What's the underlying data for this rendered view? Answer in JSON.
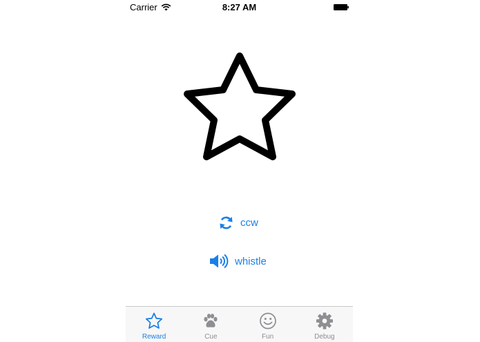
{
  "status_bar": {
    "carrier": "Carrier",
    "time": "8:27 AM"
  },
  "main": {
    "star_icon": "star-outline-icon",
    "actions": [
      {
        "label": "ccw",
        "icon": "refresh-icon"
      },
      {
        "label": "whistle",
        "icon": "speaker-icon"
      }
    ]
  },
  "tab_bar": {
    "tabs": [
      {
        "label": "Reward",
        "icon": "star-icon",
        "active": true
      },
      {
        "label": "Cue",
        "icon": "paw-icon",
        "active": false
      },
      {
        "label": "Fun",
        "icon": "smiley-icon",
        "active": false
      },
      {
        "label": "Debug",
        "icon": "gear-icon",
        "active": false
      }
    ]
  },
  "colors": {
    "accent": "#1a7fe8",
    "inactive": "#8e8e93",
    "tab_bar_bg": "#f7f7f7"
  }
}
